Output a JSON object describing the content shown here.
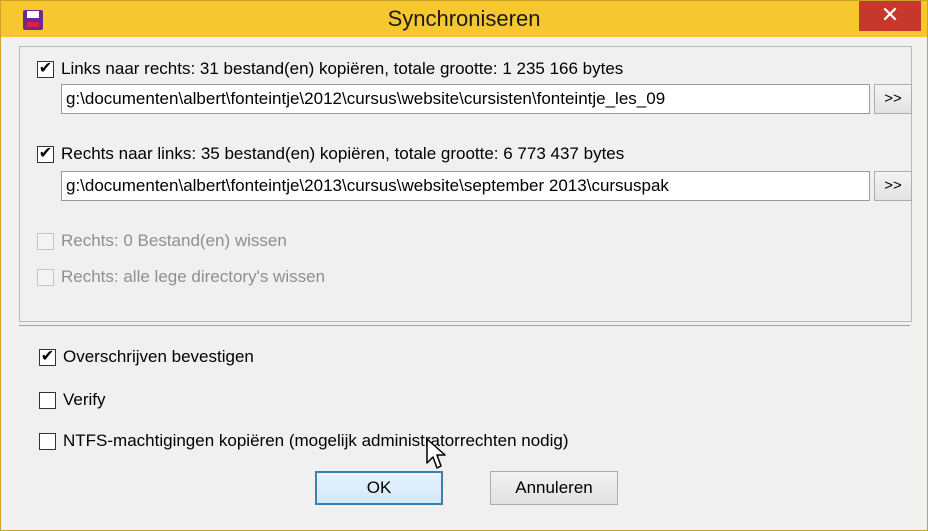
{
  "window": {
    "title": "Synchroniseren",
    "close_glyph": "✕",
    "icon": "floppy-disk-icon"
  },
  "copy_left_to_right": {
    "checked": true,
    "label": "Links naar rechts: 31 bestand(en) kopiëren, totale grootte: 1 235 166 bytes",
    "path": "g:\\documenten\\albert\\fonteintje\\2012\\cursus\\website\\cursisten\\fonteintje_les_09",
    "browse_label": ">>"
  },
  "copy_right_to_left": {
    "checked": true,
    "label": "Rechts naar links: 35 bestand(en) kopiëren, totale grootte: 6 773 437 bytes",
    "path": "g:\\documenten\\albert\\fonteintje\\2013\\cursus\\website\\september 2013\\cursuspak",
    "browse_label": ">>"
  },
  "delete_files": {
    "checked": false,
    "enabled": false,
    "label": "Rechts: 0 Bestand(en) wissen"
  },
  "delete_empty_dirs": {
    "checked": false,
    "enabled": false,
    "label": "Rechts: alle lege directory's wissen"
  },
  "options": {
    "confirm_overwrite": {
      "checked": true,
      "label": "Overschrijven bevestigen"
    },
    "verify": {
      "checked": false,
      "label": "Verify"
    },
    "ntfs_permissions": {
      "checked": false,
      "label": "NTFS-machtigingen kopiëren (mogelijk administratorrechten nodig)"
    }
  },
  "buttons": {
    "ok": "OK",
    "cancel": "Annuleren"
  },
  "check_glyph": "✔",
  "colors": {
    "titlebar": "#f6c72f",
    "close": "#c7372c",
    "default_button_border": "#3c7fb1"
  }
}
